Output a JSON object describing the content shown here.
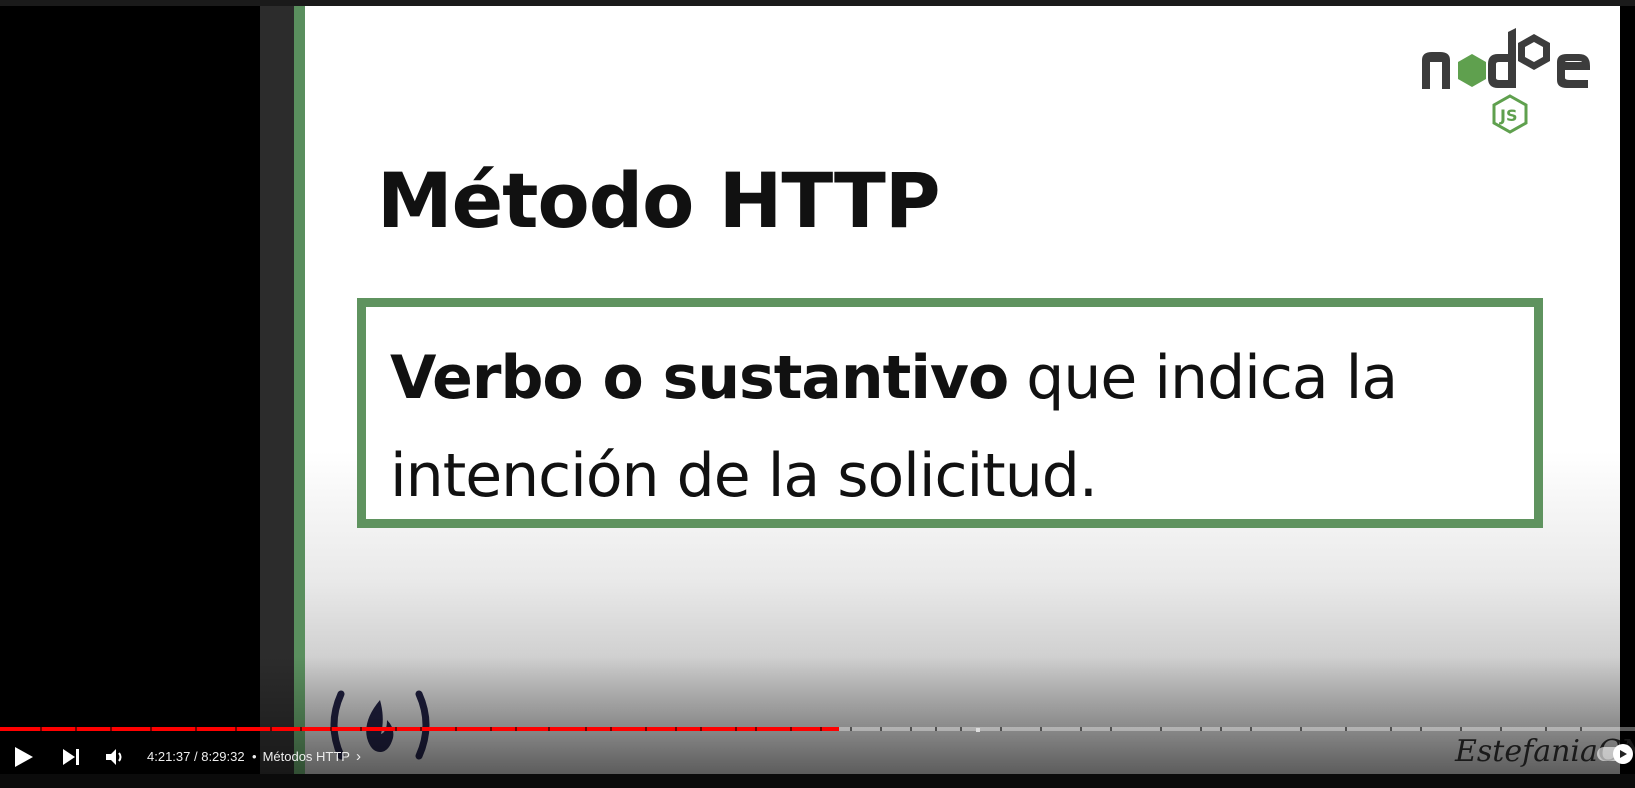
{
  "slide": {
    "title": "Método HTTP",
    "definition_bold": "Verbo o sustantivo",
    "definition_rest": " que indica la intención de la solicitud.",
    "accent_color": "#5f935f",
    "logo_text": "node",
    "logo_badge": "JS",
    "footer_logo": "freecodecamp-logo",
    "watermark": "EstefaniaCN"
  },
  "player": {
    "time_display": "4:21:37 / 8:29:32",
    "chapter_separator": "•",
    "chapter_title": "Métodos HTTP",
    "chapter_chevron": "›",
    "progress_fraction": 0.513,
    "progress_color": "#ff0000",
    "icons": [
      "play-icon",
      "next-icon",
      "volume-icon",
      "chevron-right-icon",
      "autoplay-icon"
    ]
  }
}
